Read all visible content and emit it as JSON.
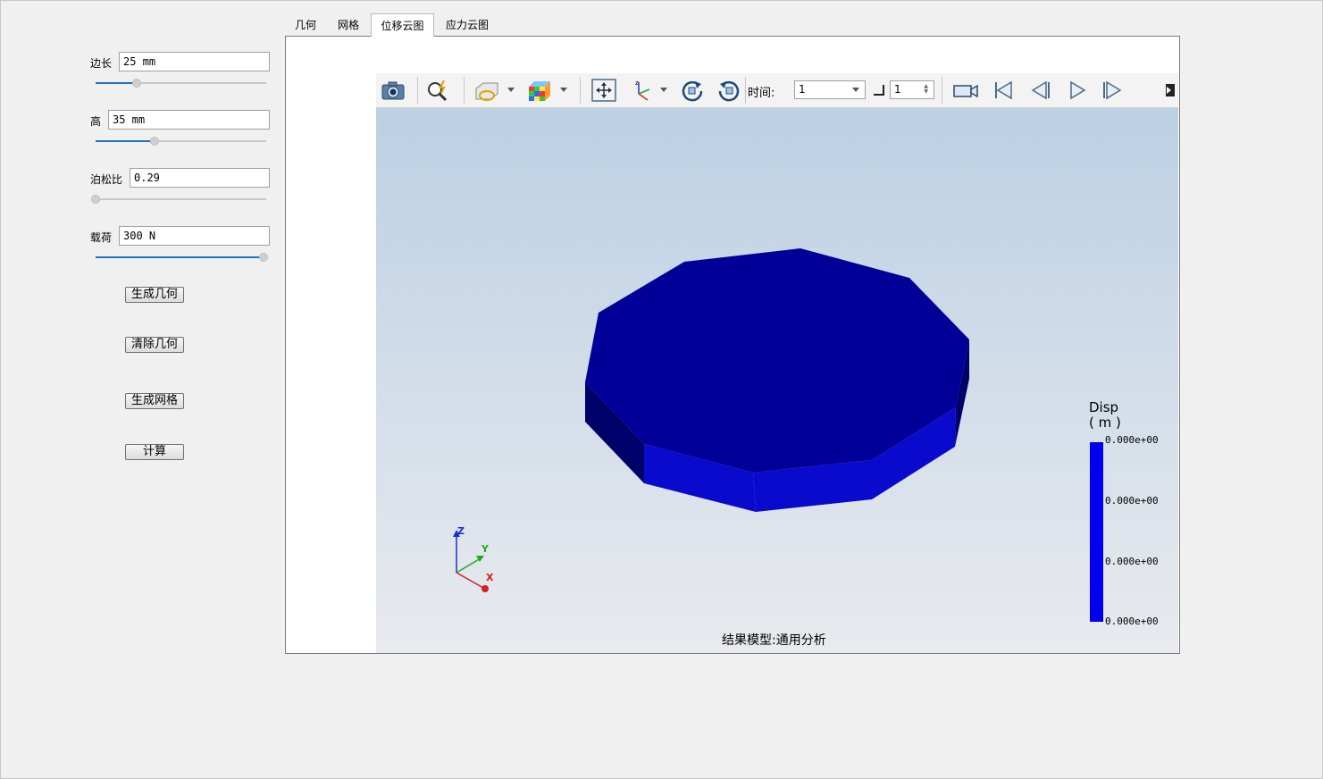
{
  "params": [
    {
      "label": "边长",
      "value": "25 mm",
      "slider_fraction": 0.25
    },
    {
      "label": "高",
      "value": "35 mm",
      "slider_fraction": 0.35
    },
    {
      "label": "泊松比",
      "value": "0.29",
      "slider_fraction": 0.0
    },
    {
      "label": "载荷",
      "value": "300 N",
      "slider_fraction": 1.0
    }
  ],
  "buttons": {
    "generate_geometry": "生成几何",
    "clear_geometry": "清除几何",
    "generate_mesh": "生成网格",
    "compute": "计算"
  },
  "tabs": [
    {
      "label": "几何",
      "active": false
    },
    {
      "label": "网格",
      "active": false
    },
    {
      "label": "位移云图",
      "active": true
    },
    {
      "label": "应力云图",
      "active": false
    }
  ],
  "toolbar": {
    "time_label": "时间:",
    "time_value": "1",
    "step_value": "1"
  },
  "legend": {
    "title": "Disp",
    "unit": "( m )",
    "values": [
      "0.000e+00",
      "0.000e+00",
      "0.000e+00",
      "0.000e+00"
    ],
    "color": "#0000ee"
  },
  "triad": {
    "z": "Z",
    "y": "Y",
    "x": "X"
  },
  "caption": "结果模型:通用分析",
  "colors": {
    "top_face": "#000099",
    "side_face_light": "#0a0acc",
    "side_face_dark": "#00006a"
  }
}
